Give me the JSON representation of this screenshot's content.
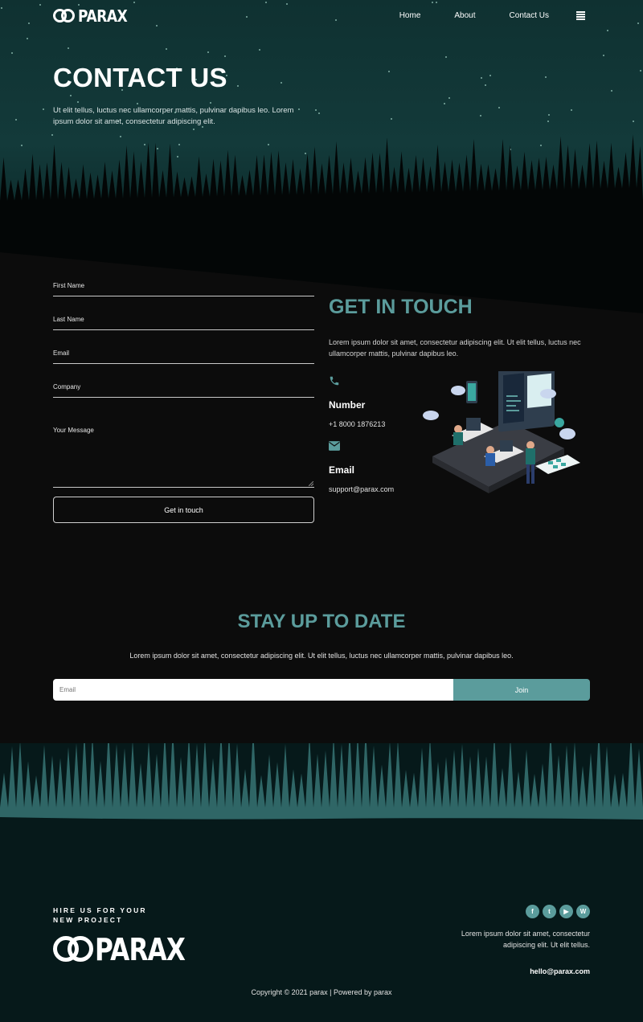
{
  "brand": {
    "name": "PARAX"
  },
  "nav": {
    "home": "Home",
    "about": "About",
    "contact": "Contact Us",
    "menu_icon": "hamburger-icon"
  },
  "hero": {
    "title": "CONTACT US",
    "subtitle": "Ut elit tellus, luctus nec ullamcorper mattis, pulvinar dapibus leo. Lorem ipsum dolor sit amet, consectetur adipiscing elit."
  },
  "form": {
    "first_name": "First Name",
    "last_name": "Last Name",
    "email": "Email",
    "company": "Company",
    "message": "Your Message",
    "submit": "Get in touch"
  },
  "contact": {
    "title": "GET IN TOUCH",
    "text": "Lorem ipsum dolor sit amet, consectetur adipiscing elit. Ut elit tellus, luctus nec ullamcorper mattis, pulvinar dapibus leo.",
    "number_label": "Number",
    "number": "+1 8000 1876213",
    "email_label": "Email",
    "email": "support@parax.com",
    "phone_icon": "phone-icon",
    "email_icon": "envelope-icon"
  },
  "newsletter": {
    "title": "STAY UP TO DATE",
    "text": "Lorem ipsum dolor sit amet, consectetur adipiscing elit. Ut elit tellus, luctus nec ullamcorper mattis, pulvinar dapibus leo.",
    "placeholder": "Email",
    "button": "Join"
  },
  "footer": {
    "hire_line1": "HIRE US FOR YOUR",
    "hire_line2": "NEW PROJECT",
    "text": "Lorem ipsum dolor sit amet, consectetur adipiscing elit. Ut elit tellus.",
    "email": "hello@parax.com",
    "copyright": "Copyright © 2021 parax | Powered by parax",
    "socials": [
      "facebook-icon",
      "twitter-icon",
      "youtube-icon",
      "wordpress-icon"
    ]
  },
  "colors": {
    "accent": "#5b9c9c",
    "background": "#0c0c0c",
    "hero": "#133a3a",
    "footer": "#06191a"
  }
}
